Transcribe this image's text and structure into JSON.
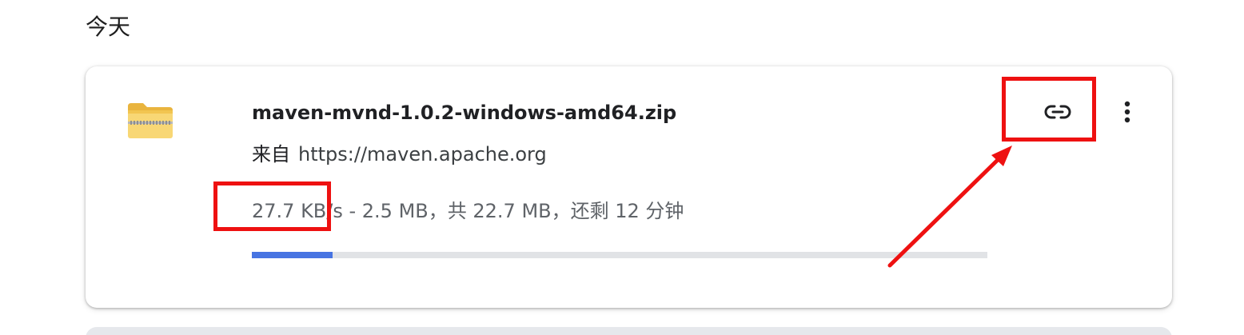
{
  "section": {
    "title": "今天"
  },
  "download": {
    "file_name": "maven-mvnd-1.0.2-windows-amd64.zip",
    "source_prefix": "来自",
    "source_url": "https://maven.apache.org",
    "status": "27.7 KB/s - 2.5 MB，共 22.7 MB，还剩 12 分钟",
    "progress_fraction": 0.11,
    "icon": "zip-folder-icon"
  },
  "actions": {
    "copy_link_icon": "link-icon",
    "more_icon": "more-vert-icon"
  },
  "colors": {
    "progress_fill": "#4774e2",
    "progress_track": "#e1e3e6",
    "annotation": "#ee1111"
  }
}
